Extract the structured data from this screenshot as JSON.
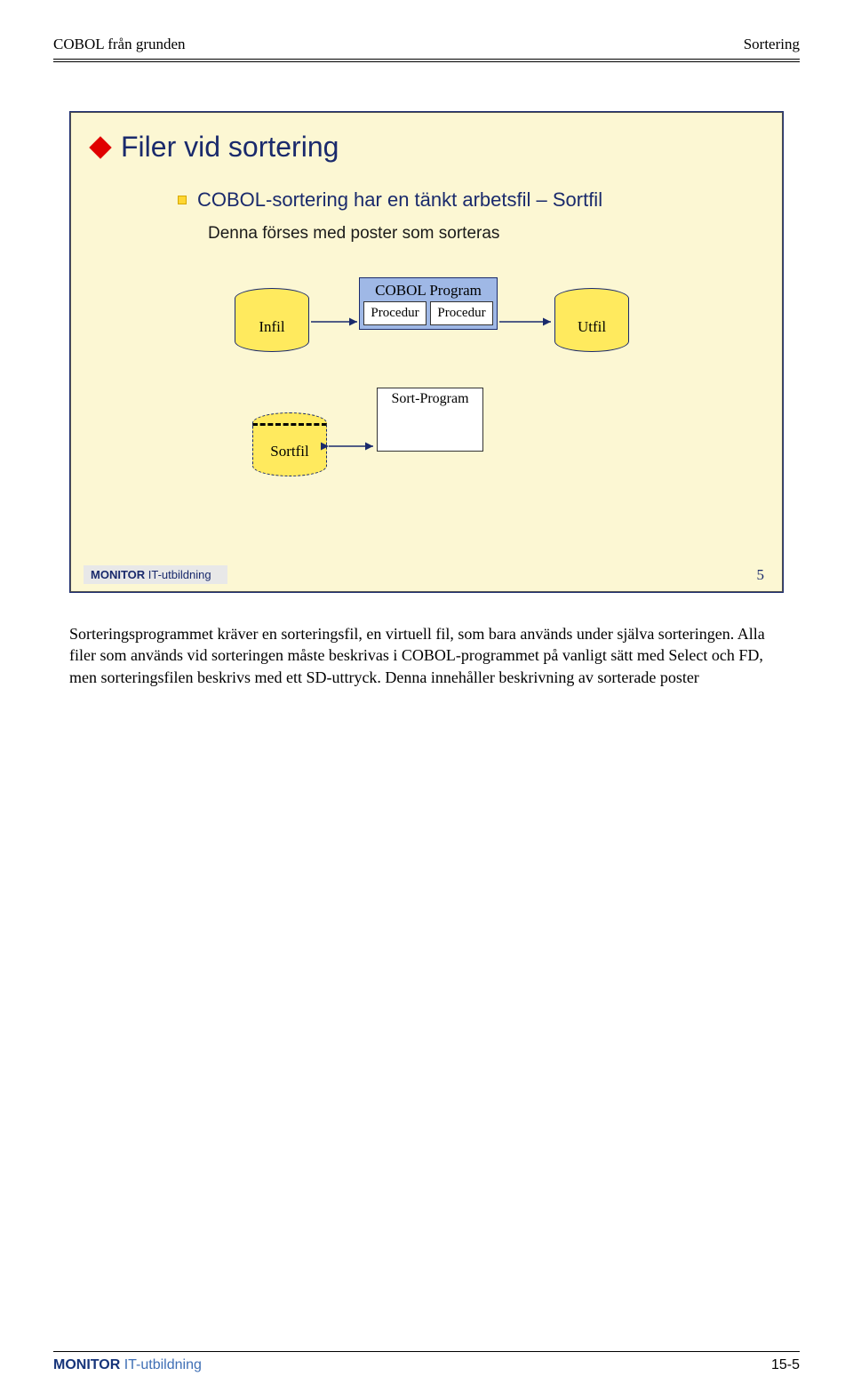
{
  "header": {
    "left": "COBOL från grunden",
    "right": "Sortering"
  },
  "slide": {
    "title": "Filer vid sortering",
    "bullet1": "COBOL-sortering har en tänkt arbetsfil – Sortfil",
    "bullet2": "Denna förses med poster som sorteras",
    "diagram": {
      "infil": "Infil",
      "utfil": "Utfil",
      "sortfil": "Sortfil",
      "cobol_program": "COBOL Program",
      "procedur": "Procedur",
      "sort_program": "Sort-Program"
    },
    "footer_brand_bold": "MONITOR",
    "footer_brand_rest": " IT-utbildning",
    "page_number": "5"
  },
  "paragraph": "Sorteringsprogrammet kräver en sorteringsfil, en virtuell fil, som bara används under själva sorteringen. Alla filer som används vid sorteringen måste beskrivas i COBOL-programmet på vanligt sätt med Select och FD, men sorteringsfilen beskrivs med ett SD-uttryck. Denna innehåller beskrivning av sorterade poster",
  "footer": {
    "brand_bold": "MONITOR",
    "brand_rest": " IT-utbildning",
    "page": "15-5"
  }
}
